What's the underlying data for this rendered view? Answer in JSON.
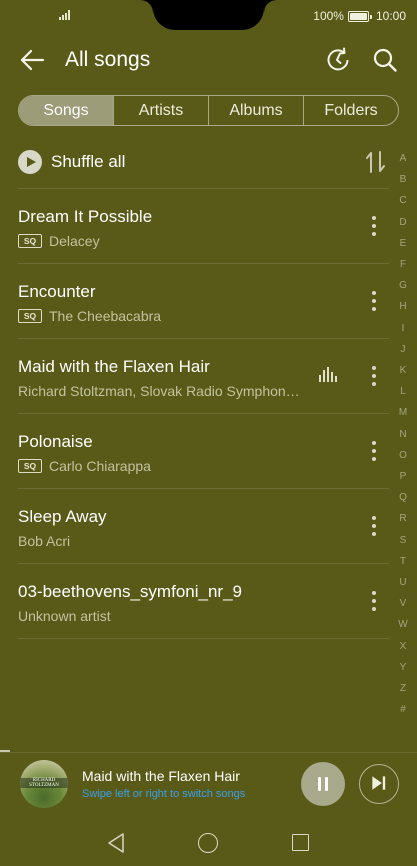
{
  "status_bar": {
    "battery_percent": "100%",
    "time": "10:00"
  },
  "header": {
    "title": "All songs"
  },
  "tabs": [
    {
      "label": "Songs",
      "active": true
    },
    {
      "label": "Artists",
      "active": false
    },
    {
      "label": "Albums",
      "active": false
    },
    {
      "label": "Folders",
      "active": false
    }
  ],
  "shuffle": {
    "label": "Shuffle all"
  },
  "songs": [
    {
      "title": "Dream It Possible",
      "artist": "Delacey",
      "sq": true,
      "playing": false
    },
    {
      "title": "Encounter",
      "artist": "The Cheebacabra",
      "sq": true,
      "playing": false
    },
    {
      "title": "Maid with the Flaxen Hair",
      "artist": "Richard Stoltzman, Slovak Radio Symphon…",
      "sq": false,
      "playing": true
    },
    {
      "title": "Polonaise",
      "artist": "Carlo Chiarappa",
      "sq": true,
      "playing": false
    },
    {
      "title": "Sleep Away",
      "artist": "Bob Acri",
      "sq": false,
      "playing": false
    },
    {
      "title": "03-beethovens_symfoni_nr_9",
      "artist": "Unknown artist",
      "sq": false,
      "playing": false
    }
  ],
  "sq_badge": "SQ",
  "alphabet": [
    "A",
    "B",
    "C",
    "D",
    "E",
    "F",
    "G",
    "H",
    "I",
    "J",
    "K",
    "L",
    "M",
    "N",
    "O",
    "P",
    "Q",
    "R",
    "S",
    "T",
    "U",
    "V",
    "W",
    "X",
    "Y",
    "Z",
    "#"
  ],
  "now_playing": {
    "title": "Maid with the Flaxen Hair",
    "hint": "Swipe left or right to switch songs",
    "cover_text_1": "RICHARD",
    "cover_text_2": "STOLTZMAN"
  },
  "colors": {
    "background": "#5a5a18",
    "active_tab": "#9c9c78",
    "hint": "#3ba0e8"
  },
  "icons": {
    "back": "back-arrow-icon",
    "refresh": "refresh-icon",
    "search": "search-icon",
    "shuffle": "play-circle-icon",
    "sort": "sort-icon",
    "more": "more-vertical-icon",
    "playing": "equalizer-icon",
    "pause": "pause-icon",
    "next": "skip-next-icon"
  }
}
